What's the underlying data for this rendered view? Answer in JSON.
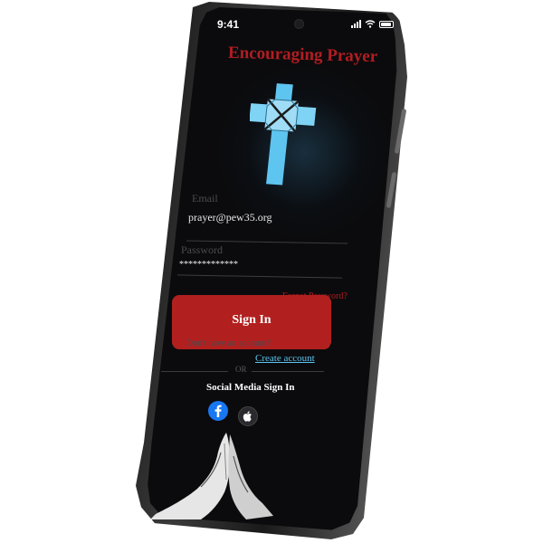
{
  "status_bar": {
    "time": "9:41"
  },
  "app": {
    "title": "Encouraging Prayer"
  },
  "login_form": {
    "email_label": "Email",
    "email_value": "prayer@pew35.org",
    "password_label": "Password",
    "password_value": "*************",
    "forgot_password": "Forgot Password?",
    "sign_in_label": "Sign In",
    "no_account_text": "Don't have an account?",
    "create_account_link": "Create account",
    "or_divider": "OR",
    "social_heading": "Social Media Sign In"
  },
  "social": [
    {
      "name": "facebook",
      "icon": "facebook-icon"
    },
    {
      "name": "apple",
      "icon": "apple-icon"
    }
  ],
  "colors": {
    "accent_red": "#b11d22",
    "link_blue": "#5ec4f0",
    "cross_blue": "#5ec4f0",
    "background": "#0b0b0d"
  }
}
